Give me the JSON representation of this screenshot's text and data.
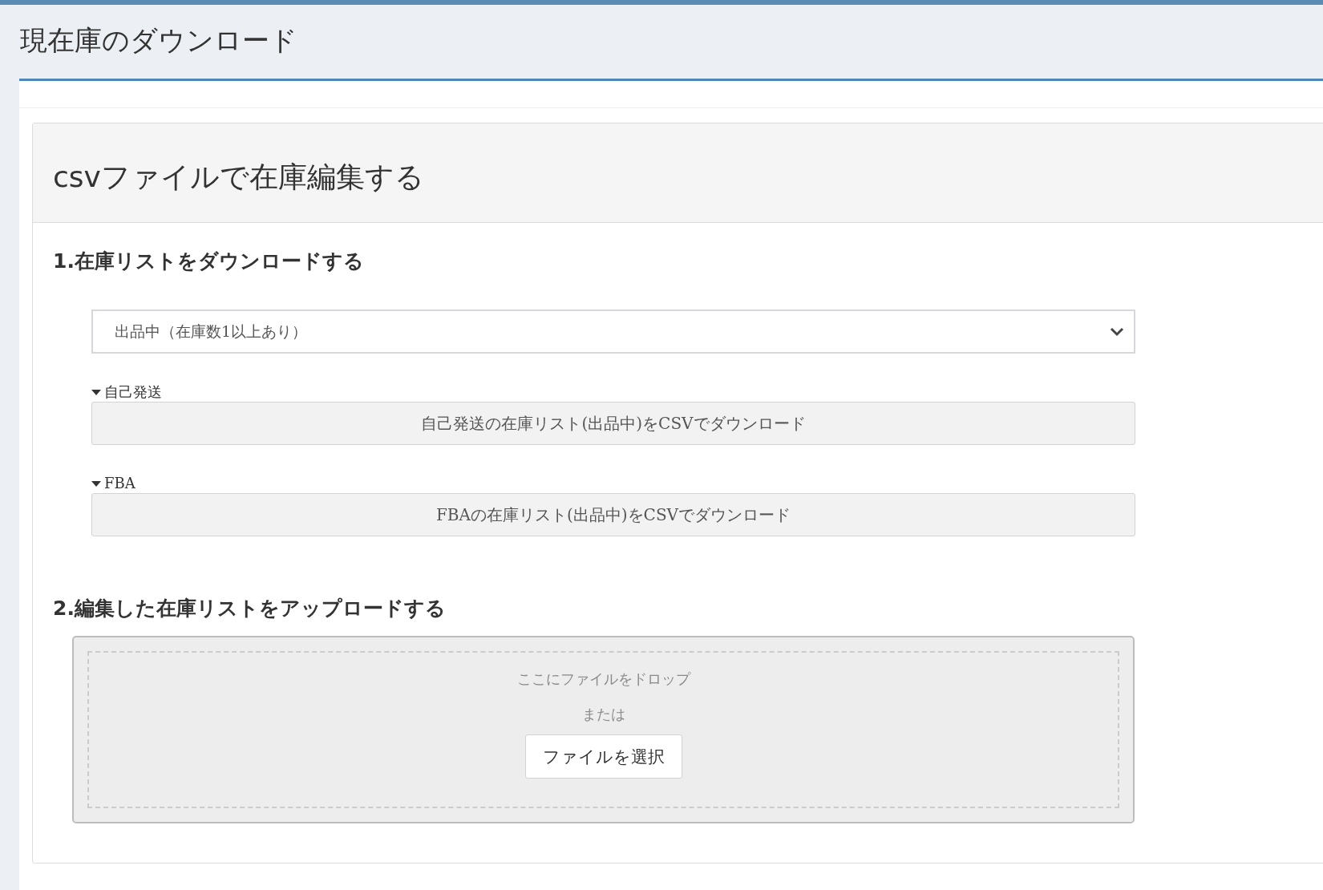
{
  "page_title": "現在庫のダウンロード",
  "card": {
    "title": "csvファイルで在庫編集する",
    "download_section": {
      "heading": "1.在庫リストをダウンロードする",
      "filter_select": {
        "value": "出品中（在庫数1以上あり）"
      },
      "groups": [
        {
          "label": "自己発送",
          "expanded": true,
          "button": "自己発送の在庫リスト(出品中)をCSVでダウンロード"
        },
        {
          "label": "FBA",
          "expanded": true,
          "button": "FBAの在庫リスト(出品中)をCSVでダウンロード"
        }
      ]
    },
    "upload_section": {
      "heading": "2.編集した在庫リストをアップロードする",
      "drop_text": "ここにファイルをドロップ",
      "or_text": "または",
      "choose_button": "ファイルを選択"
    }
  }
}
